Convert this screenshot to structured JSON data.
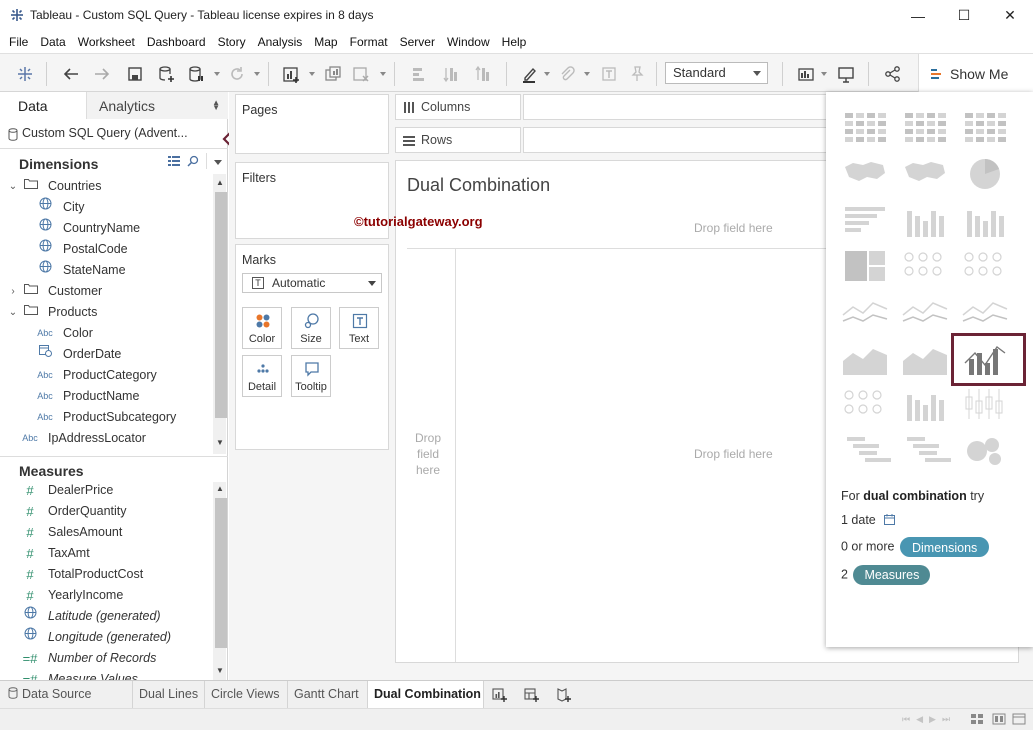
{
  "window": {
    "title": "Tableau - Custom SQL Query - Tableau license expires in 8 days",
    "minimize": "—",
    "maximize": "☐",
    "close": "✕"
  },
  "menu": [
    "File",
    "Data",
    "Worksheet",
    "Dashboard",
    "Story",
    "Analysis",
    "Map",
    "Format",
    "Server",
    "Window",
    "Help"
  ],
  "toolbar": {
    "fit_select": "Standard",
    "show_me_label": "Show Me"
  },
  "data_pane": {
    "tab_data": "Data",
    "tab_analytics": "Analytics",
    "datasource": "Custom SQL Query (Advent...",
    "dimensions_label": "Dimensions",
    "dimensions": [
      {
        "label": "Countries",
        "type": "folder",
        "expanded": true
      },
      {
        "label": "City",
        "type": "geo"
      },
      {
        "label": "CountryName",
        "type": "geo"
      },
      {
        "label": "PostalCode",
        "type": "geo"
      },
      {
        "label": "StateName",
        "type": "geo"
      },
      {
        "label": "Customer",
        "type": "folder",
        "expanded": false
      },
      {
        "label": "Products",
        "type": "folder",
        "expanded": true
      },
      {
        "label": "Color",
        "type": "abc"
      },
      {
        "label": "OrderDate",
        "type": "date"
      },
      {
        "label": "ProductCategory",
        "type": "abc"
      },
      {
        "label": "ProductName",
        "type": "abc"
      },
      {
        "label": "ProductSubcategory",
        "type": "abc"
      },
      {
        "label": "IpAddressLocator",
        "type": "abc"
      }
    ],
    "measures_label": "Measures",
    "measures": [
      {
        "label": "DealerPrice",
        "type": "num"
      },
      {
        "label": "OrderQuantity",
        "type": "num"
      },
      {
        "label": "SalesAmount",
        "type": "num"
      },
      {
        "label": "TaxAmt",
        "type": "num"
      },
      {
        "label": "TotalProductCost",
        "type": "num"
      },
      {
        "label": "YearlyIncome",
        "type": "num"
      },
      {
        "label": "Latitude (generated)",
        "type": "geo",
        "italic": true
      },
      {
        "label": "Longitude (generated)",
        "type": "geo",
        "italic": true
      },
      {
        "label": "Number of Records",
        "type": "num",
        "italic": true
      },
      {
        "label": "Measure Values",
        "type": "num",
        "italic": true
      }
    ],
    "abc_icon": "Abc",
    "num_icon": "#"
  },
  "shelves": {
    "pages": "Pages",
    "filters": "Filters",
    "marks": "Marks",
    "marks_type": "Automatic",
    "mark_buttons": [
      "Color",
      "Size",
      "Text",
      "Detail",
      "Tooltip"
    ],
    "columns": "Columns",
    "rows": "Rows"
  },
  "view": {
    "sheet_title": "Dual Combination",
    "watermark": "©tutorialgateway.org",
    "drop_top": "Drop field here",
    "drop_left": "Drop\nfield\nhere",
    "drop_center": "Drop field here"
  },
  "show_me": {
    "hint_prefix": "For",
    "hint_chart": "dual combination",
    "hint_suffix": "try",
    "req_date": "1 date",
    "req_dims_text": "0 or more",
    "req_dims_pill": "Dimensions",
    "req_meas_count": "2",
    "req_meas_pill": "Measures",
    "dim_color": "#4996b2",
    "meas_color": "#4f8a93",
    "highlight_color": "#6b2335"
  },
  "bottom_tabs": [
    {
      "label": "Data Source",
      "active": false
    },
    {
      "label": "Dual Lines",
      "active": false
    },
    {
      "label": "Circle Views",
      "active": false
    },
    {
      "label": "Gantt Chart",
      "active": false
    },
    {
      "label": "Dual Combination",
      "active": true
    }
  ],
  "annotation_arrow_color": "#6b2335"
}
